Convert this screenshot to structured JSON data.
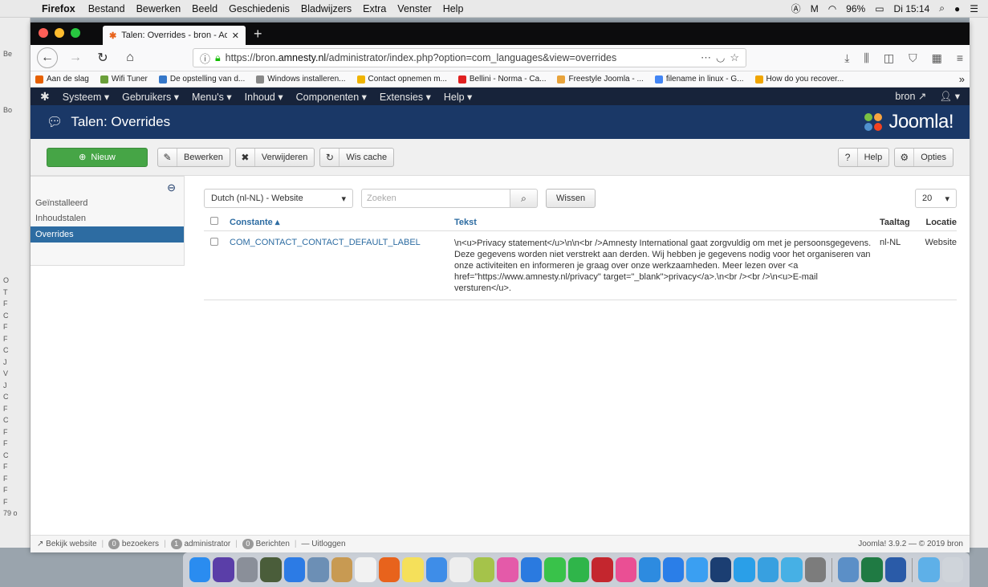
{
  "macos": {
    "menu_app": "Firefox",
    "menu_items": [
      "Bestand",
      "Bewerken",
      "Beeld",
      "Geschiedenis",
      "Bladwijzers",
      "Extra",
      "Venster",
      "Help"
    ],
    "battery": "96%",
    "clock": "Di 15:14"
  },
  "browser": {
    "tab_title": "Talen: Overrides - bron - Admin",
    "url_prefix": "https://bron.",
    "url_domain": "amnesty.nl",
    "url_path": "/administrator/index.php?option=com_languages&view=overrides",
    "bookmarks": [
      {
        "label": "Aan de slag",
        "color": "#e66000"
      },
      {
        "label": "Wifi Tuner",
        "color": "#6a9f3a"
      },
      {
        "label": "De opstelling van d...",
        "color": "#3577c9"
      },
      {
        "label": "Windows installeren...",
        "color": "#888888"
      },
      {
        "label": "Contact opnemen m...",
        "color": "#f0b400"
      },
      {
        "label": "Bellini - Norma - Ca...",
        "color": "#e02020"
      },
      {
        "label": "Freestyle Joomla - ...",
        "color": "#e8a33b"
      },
      {
        "label": "filename in linux - G...",
        "color": "#4285f4"
      },
      {
        "label": "How do you recover...",
        "color": "#f0a500"
      }
    ]
  },
  "joomla": {
    "nav": [
      "Systeem ▾",
      "Gebruikers ▾",
      "Menu's ▾",
      "Inhoud ▾",
      "Componenten ▾",
      "Extensies ▾",
      "Help ▾"
    ],
    "nav_user": "bron",
    "page_title": "Talen: Overrides",
    "brand": "Joomla!",
    "toolbar": {
      "new": "Nieuw",
      "edit": "Bewerken",
      "delete": "Verwijderen",
      "clear_cache": "Wis cache",
      "help": "Help",
      "options": "Opties"
    },
    "sidebar": {
      "items": [
        "Geïnstalleerd",
        "Inhoudstalen",
        "Overrides"
      ],
      "active": "Overrides"
    },
    "filters": {
      "language": "Dutch (nl-NL) - Website",
      "search_placeholder": "Zoeken",
      "clear": "Wissen",
      "limit": "20"
    },
    "table": {
      "headers": {
        "constant": "Constante ▴",
        "text": "Tekst",
        "tag": "Taaltag",
        "location": "Locatie"
      },
      "rows": [
        {
          "constant": "COM_CONTACT_CONTACT_DEFAULT_LABEL",
          "text": "\\n<u>Privacy statement</u>\\n\\n<br />Amnesty International gaat zorgvuldig om met je persoonsgegevens. Deze gegevens worden niet verstrekt aan derden. Wij hebben je gegevens nodig voor het organiseren van onze activiteiten en informeren je graag over onze werkzaamheden. Meer lezen over <a href=\"https://www.amnesty.nl/privacy\" target=\"_blank\">privacy</a>.\\n<br /><br />\\n<u>E-mail versturen</u>.",
          "tag": "nl-NL",
          "location": "Website"
        }
      ]
    },
    "status": {
      "view_site": "Bekijk website",
      "visitors_count": "0",
      "visitors": "bezoekers",
      "admin_count": "1",
      "admin": "administrator",
      "messages_count": "0",
      "messages": "Berichten",
      "logout": "Uitloggen",
      "version": "Joomla! 3.9.2 — © 2019 bron"
    }
  },
  "behind_left_letters": [
    "Be",
    "Bo",
    "O",
    "T",
    "F",
    "C",
    "F",
    "F",
    "C",
    "J",
    "V",
    "J",
    "C",
    "F",
    "C",
    "F",
    "F",
    "C",
    "F",
    "F",
    "F",
    "F",
    "79 o"
  ],
  "dock_icons": [
    {
      "name": "finder-icon",
      "color": "#2a8cf0"
    },
    {
      "name": "siri-icon",
      "color": "#5a3ea8"
    },
    {
      "name": "launchpad-icon",
      "color": "#8a8f99"
    },
    {
      "name": "mission-control-icon",
      "color": "#4a5d3a"
    },
    {
      "name": "safari-icon",
      "color": "#2c7be5"
    },
    {
      "name": "preview-icon",
      "color": "#6c8fb5"
    },
    {
      "name": "notes-icon",
      "color": "#c89a52"
    },
    {
      "name": "calendar-icon",
      "color": "#f2f2f2"
    },
    {
      "name": "firefox-icon",
      "color": "#e8631c"
    },
    {
      "name": "stickies-icon",
      "color": "#f5e05a"
    },
    {
      "name": "pages-icon",
      "color": "#3e8de8"
    },
    {
      "name": "reminders-icon",
      "color": "#eeeeee"
    },
    {
      "name": "photos-icon",
      "color": "#a5c34a"
    },
    {
      "name": "itunes-icon",
      "color": "#e45aa9"
    },
    {
      "name": "vpn-icon",
      "color": "#2a7ae0"
    },
    {
      "name": "messages-icon",
      "color": "#39c24a"
    },
    {
      "name": "facetime-icon",
      "color": "#2fb54a"
    },
    {
      "name": "filezilla-icon",
      "color": "#c4262e"
    },
    {
      "name": "music-icon",
      "color": "#ea4f94"
    },
    {
      "name": "network-icon",
      "color": "#2d8be0"
    },
    {
      "name": "appstore-icon",
      "color": "#2a7ee8"
    },
    {
      "name": "sync-icon",
      "color": "#3a9ff2"
    },
    {
      "name": "terminal-icon",
      "color": "#1b3e72"
    },
    {
      "name": "skype-icon",
      "color": "#2a9fe8"
    },
    {
      "name": "shield-app-icon",
      "color": "#38a0e0"
    },
    {
      "name": "mindnode-icon",
      "color": "#46b0e5"
    },
    {
      "name": "system-preferences-icon",
      "color": "#7c7c7c"
    },
    {
      "name": "scanner-icon",
      "color": "#5b8fc7"
    },
    {
      "name": "excel-icon",
      "color": "#1f7a43"
    },
    {
      "name": "word-icon",
      "color": "#2a5ba8"
    },
    {
      "name": "folder-icon",
      "color": "#5eb0e8"
    },
    {
      "name": "trash-icon",
      "color": "#cfd4da"
    }
  ]
}
